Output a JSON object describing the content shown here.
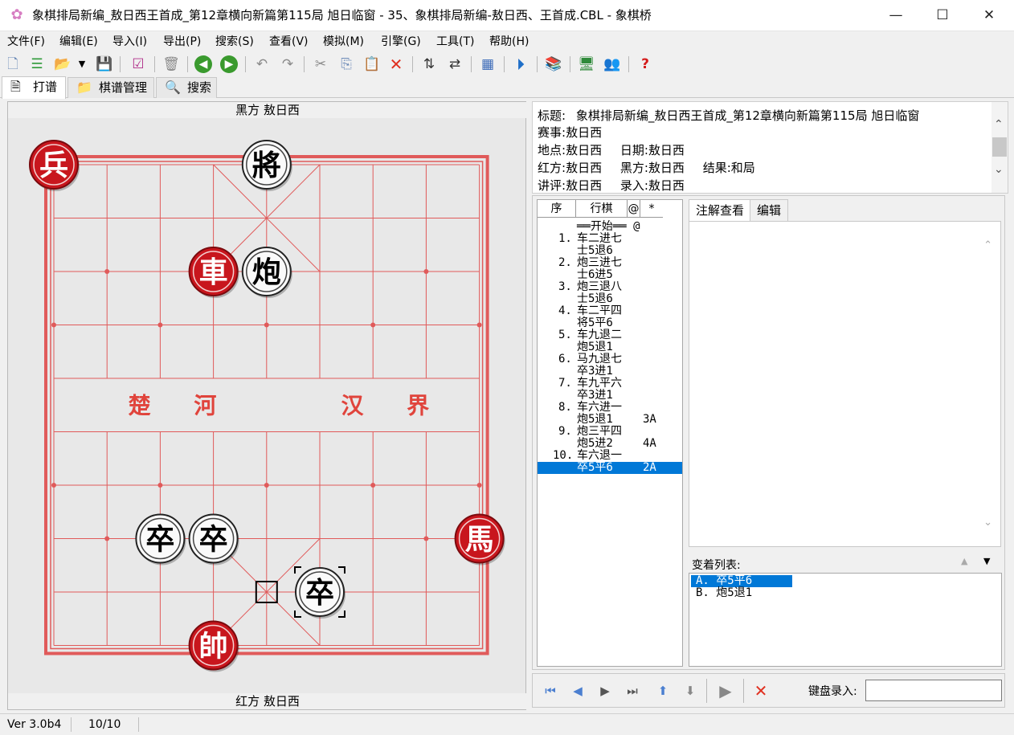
{
  "window": {
    "title": "象棋排局新编_敖日西王首成_第12章横向新篇第115局 旭日临窗 - 35、象棋排局新编-敖日西、王首成.CBL - 象棋桥",
    "app_icon": "flower-icon",
    "minimize": "—",
    "maximize": "☐",
    "close": "✕"
  },
  "menu": [
    "文件(F)",
    "编辑(E)",
    "导入(I)",
    "导出(P)",
    "搜索(S)",
    "查看(V)",
    "模拟(M)",
    "引擎(G)",
    "工具(T)",
    "帮助(H)"
  ],
  "toolbar_icons": [
    "new-file-icon",
    "list-icon",
    "open-folder-icon",
    "dropdown-arrow-icon",
    "save-icon",
    "checklist-icon",
    "trash-icon",
    "back-green-icon",
    "forward-green-icon",
    "undo-icon",
    "redo-icon",
    "cut-icon",
    "copy-icon",
    "paste-icon",
    "delete-red-x-icon",
    "flip-vertical-icon",
    "swap-horizontal-icon",
    "board-grid-icon",
    "play-circle-icon",
    "book-icon",
    "computer-engine-icon",
    "people-icon",
    "help-question-icon"
  ],
  "tabs": [
    {
      "label": "打谱",
      "icon": "document-icon"
    },
    {
      "label": "棋谱管理",
      "icon": "folder-icon"
    },
    {
      "label": "搜索",
      "icon": "magnifier-icon"
    }
  ],
  "board": {
    "top_label": "黑方 敖日西",
    "bottom_label": "红方 敖日西",
    "river_left": "楚 河",
    "river_right": "汉 界",
    "pieces": [
      {
        "char": "兵",
        "side": "red",
        "file": 0,
        "rank": 0
      },
      {
        "char": "將",
        "side": "black",
        "file": 4,
        "rank": 0
      },
      {
        "char": "車",
        "side": "red",
        "file": 3,
        "rank": 2
      },
      {
        "char": "炮",
        "side": "black",
        "file": 4,
        "rank": 2
      },
      {
        "char": "卒",
        "side": "black",
        "file": 2,
        "rank": 7
      },
      {
        "char": "卒",
        "side": "black",
        "file": 3,
        "rank": 7
      },
      {
        "char": "馬",
        "side": "red",
        "file": 8,
        "rank": 7
      },
      {
        "char": "卒",
        "side": "black",
        "file": 5,
        "rank": 8
      },
      {
        "char": "帥",
        "side": "red",
        "file": 3,
        "rank": 9
      }
    ],
    "last_move_from": {
      "file": 4,
      "rank": 8
    },
    "last_move_to": {
      "file": 5,
      "rank": 8
    }
  },
  "info": {
    "title_label": "标题:",
    "title": "象棋排局新编_敖日西王首成_第12章横向新篇第115局 旭日临窗",
    "event_label": "赛事:",
    "event": "敖日西",
    "place_label": "地点:",
    "place": "敖日西",
    "date_label": "日期:",
    "date": "敖日西",
    "red_label": "红方:",
    "red": "敖日西",
    "black_label": "黑方:",
    "black": "敖日西",
    "result_label": "结果:",
    "result": "和局",
    "commentator_label": "讲评:",
    "commentator": "敖日西",
    "recorder_label": "录入:",
    "recorder": "敖日西"
  },
  "movelist": {
    "headers": [
      "序",
      "行棋",
      "@",
      "*"
    ],
    "start": "══开始══ @",
    "rows": [
      {
        "no": "1.",
        "red": "车二进七",
        "black": "士5退6",
        "var": ""
      },
      {
        "no": "2.",
        "red": "炮三进七",
        "black": "士6进5",
        "var": ""
      },
      {
        "no": "3.",
        "red": "炮三退八",
        "black": "士5退6",
        "var": ""
      },
      {
        "no": "4.",
        "red": "车二平四",
        "black": "将5平6",
        "var": ""
      },
      {
        "no": "5.",
        "red": "车九退二",
        "black": "炮5退1",
        "var": ""
      },
      {
        "no": "6.",
        "red": "马九退七",
        "black": "卒3进1",
        "var": ""
      },
      {
        "no": "7.",
        "red": "车九平六",
        "black": "卒3进1",
        "var": ""
      },
      {
        "no": "8.",
        "red": "车六进一",
        "black": "炮5退1",
        "var": "3A"
      },
      {
        "no": "9.",
        "red": "炮三平四",
        "black": "炮5进2",
        "var": "4A"
      },
      {
        "no": "10.",
        "red": "车六退一",
        "black": "卒5平6",
        "var": "2A"
      }
    ]
  },
  "comment_tabs": [
    "注解查看",
    "编辑"
  ],
  "variations": {
    "label": "变着列表:",
    "items": [
      "A. 卒5平6",
      "B. 炮5退1"
    ]
  },
  "nav_icons": [
    "first-icon",
    "prev-icon",
    "next-icon",
    "last-icon",
    "up-variation-icon",
    "down-variation-icon",
    "play-icon",
    "stop-x-icon"
  ],
  "keyboard_input": {
    "label": "键盘录入:",
    "value": ""
  },
  "status": {
    "version": "Ver 3.0b4",
    "position": "10/10"
  },
  "colors": {
    "red_piece": "#c8161d",
    "board_line": "#e05a5a",
    "selection": "#0078d7"
  }
}
